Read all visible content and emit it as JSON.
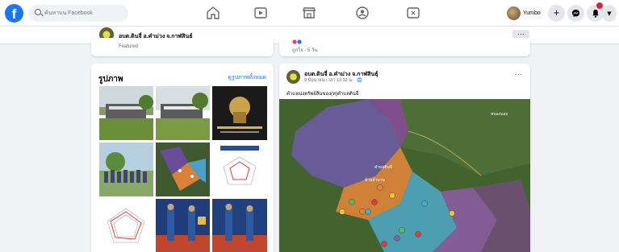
{
  "topbar": {
    "search_placeholder": "ค้นหาบน Facebook",
    "nav_icons": [
      "home-icon",
      "watch-icon",
      "marketplace-icon",
      "groups-icon",
      "gaming-icon"
    ],
    "profile_name": "Yumbo",
    "buttons": [
      "create-icon",
      "messenger-icon",
      "notifications-icon",
      "account-menu-icon"
    ],
    "brand_color": "#1877f2"
  },
  "page_header": {
    "name": "อบต.ดินจี่ อ.คำม่วง จ.กาฬสินธุ์",
    "more_label": "···"
  },
  "featured": {
    "label": "Featured"
  },
  "post_stub": {
    "meta": "ถูกใจ · 5 วัน"
  },
  "photos": {
    "title": "รูปภาพ",
    "see_all": "ดูรูปภาพทั้งหมด",
    "count": 9
  },
  "post": {
    "author": "อบต.ดินจี่ อ.คำม่วง จ.กาฬสินธุ์",
    "meta": "9 มิถุนายน เวลา 13:32 น. · 🌐",
    "body": "ตำแหน่งทรัพย์สินของ(ท)ตำบลดินจี่",
    "more_label": "···",
    "map_labels": [
      "ตำบลดินจี่",
      "บ้านบัวบาน",
      "หนองนอง"
    ]
  }
}
